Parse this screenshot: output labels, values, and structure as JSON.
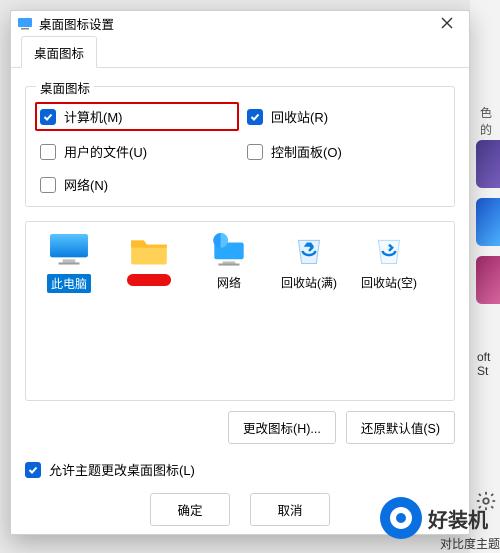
{
  "window": {
    "title": "桌面图标设置",
    "close": "✕"
  },
  "tab": {
    "label": "桌面图标"
  },
  "group": {
    "legend": "桌面图标",
    "items": {
      "computer": {
        "label": "计算机(M)",
        "checked": true
      },
      "recycle": {
        "label": "回收站(R)",
        "checked": true
      },
      "userfiles": {
        "label": "用户的文件(U)",
        "checked": false
      },
      "cpanel": {
        "label": "控制面板(O)",
        "checked": false
      },
      "network": {
        "label": "网络(N)",
        "checked": false
      }
    }
  },
  "icons": {
    "thispc": {
      "label": "此电脑"
    },
    "redacted": {
      "label": ""
    },
    "network": {
      "label": "网络"
    },
    "recyclefull": {
      "label": "回收站(满)"
    },
    "recycleemp": {
      "label": "回收站(空)"
    }
  },
  "buttons": {
    "change_icon": "更改图标(H)...",
    "restore": "还原默认值(S)"
  },
  "allow_theme": {
    "label": "允许主题更改桌面图标(L)",
    "checked": true
  },
  "footer": {
    "ok": "确定",
    "cancel": "取消"
  },
  "right_side": {
    "snippet1": "色的",
    "snippet2": "oft St",
    "snippet3": "对比度主题"
  },
  "watermark": {
    "text": "好装机"
  }
}
